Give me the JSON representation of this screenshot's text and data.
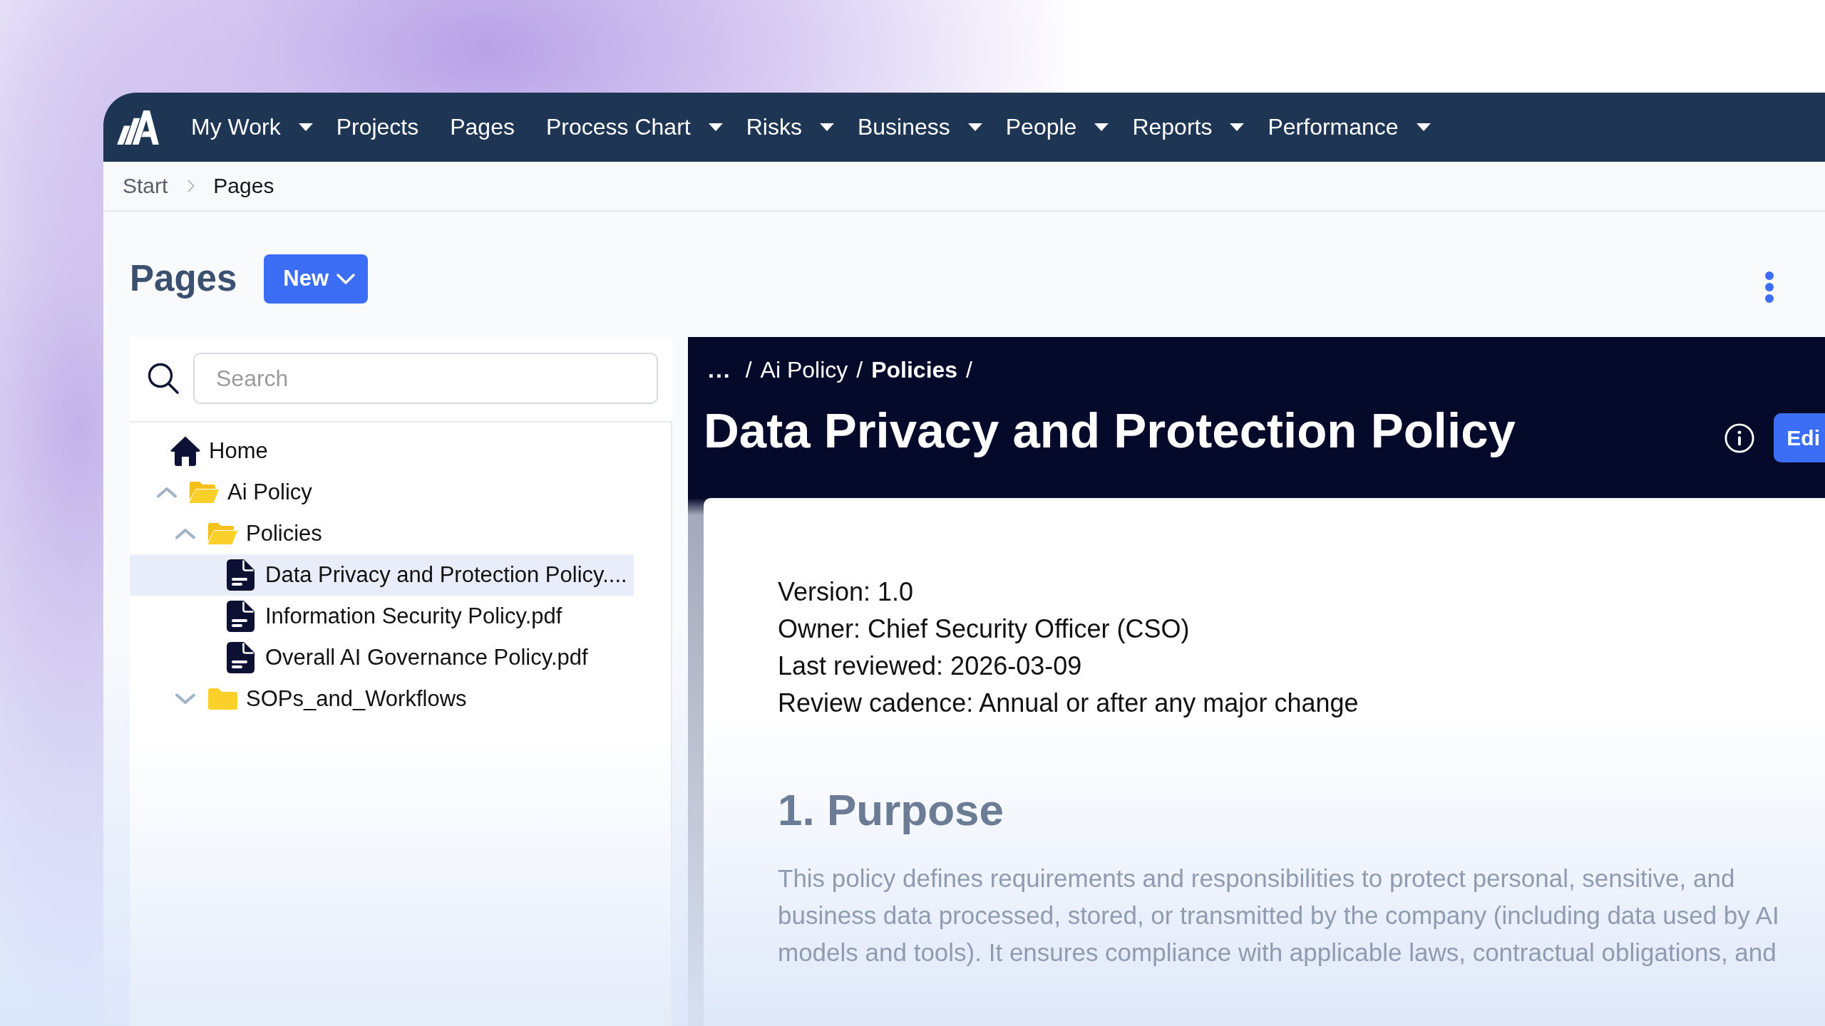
{
  "nav": {
    "items": [
      {
        "label": "My Work",
        "kind": "dropdown"
      },
      {
        "label": "Projects",
        "kind": "link"
      },
      {
        "label": "Pages",
        "kind": "link"
      },
      {
        "label": "Process Chart",
        "kind": "dropdown"
      },
      {
        "label": "Risks",
        "kind": "dropdown"
      },
      {
        "label": "Business",
        "kind": "dropdown"
      },
      {
        "label": "People",
        "kind": "dropdown"
      },
      {
        "label": "Reports",
        "kind": "dropdown"
      },
      {
        "label": "Performance",
        "kind": "dropdown"
      }
    ]
  },
  "breadcrumb": [
    {
      "label": "Start",
      "current": false
    },
    {
      "label": "Pages",
      "current": true
    }
  ],
  "page_header": {
    "title": "Pages",
    "new_button": "New"
  },
  "search": {
    "placeholder": "Search"
  },
  "tree": [
    {
      "kind": "home",
      "label": "Home",
      "selected": false,
      "children": [
        {
          "kind": "folder",
          "label": "Ai Policy",
          "expanded": true,
          "selected": false,
          "children": [
            {
              "kind": "folder",
              "label": "Policies",
              "expanded": true,
              "selected": false,
              "children": [
                {
                  "kind": "file",
                  "label": "Data Privacy and Protection Policy....",
                  "selected": true
                },
                {
                  "kind": "file",
                  "label": "Information Security Policy.pdf",
                  "selected": false
                },
                {
                  "kind": "file",
                  "label": "Overall AI Governance Policy.pdf",
                  "selected": false
                }
              ]
            },
            {
              "kind": "folder",
              "label": "SOPs_and_Workflows",
              "expanded": false,
              "selected": false
            }
          ]
        }
      ]
    }
  ],
  "document": {
    "path": [
      {
        "label": "...",
        "kind": "collapsed",
        "separator": "/"
      },
      {
        "label": "Ai Policy",
        "kind": "link",
        "current": false,
        "separator": "/"
      },
      {
        "label": "Policies",
        "kind": "link",
        "current": true,
        "separator": "/"
      }
    ],
    "title": "Data Privacy and Protection Policy",
    "edit_button": "Edi",
    "meta": [
      "Version: 1.0",
      "Owner: Chief Security Officer (CSO)",
      "Last reviewed: 2026-03-09",
      "Review cadence: Annual or after any major change"
    ],
    "sections": [
      {
        "heading": "1. Purpose",
        "paragraphs": [
          "This policy defines requirements and responsibilities to protect personal, sensitive, and business data processed, stored, or transmitted by the company (including data used by AI models and tools). It ensures compliance with applicable laws, contractual obligations, and"
        ]
      }
    ]
  }
}
